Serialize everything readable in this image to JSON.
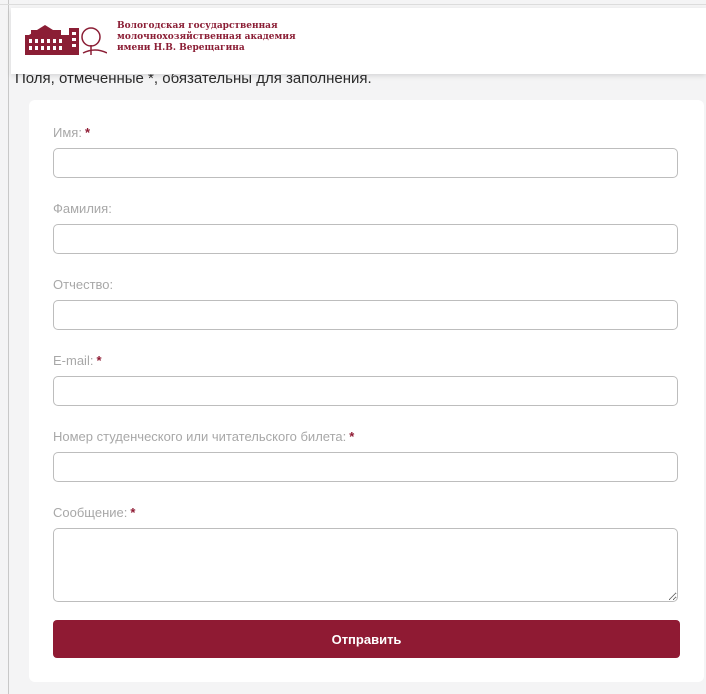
{
  "header": {
    "org_line1": "Вологодская государственная",
    "org_line2": "молочнохозяйственная академия",
    "org_line3": "имени Н.В. Верещагина",
    "brand_color": "#8f1a33",
    "logo_icon": "academy-building-logo"
  },
  "notice": "Поля, отмеченные *, обязательны для заполнения.",
  "form": {
    "required_mark": "*",
    "fields": [
      {
        "label": "Имя:",
        "required": true,
        "value": "",
        "placeholder": ""
      },
      {
        "label": "Фамилия:",
        "required": false,
        "value": "",
        "placeholder": ""
      },
      {
        "label": "Отчество:",
        "required": false,
        "value": "",
        "placeholder": ""
      },
      {
        "label": "E-mail:",
        "required": true,
        "value": "",
        "placeholder": ""
      },
      {
        "label": "Номер студенческого или читательского билета:",
        "required": true,
        "value": "",
        "placeholder": ""
      },
      {
        "label": "Сообщение:",
        "required": true,
        "value": "",
        "placeholder": ""
      }
    ],
    "submit_label": "Отправить"
  }
}
